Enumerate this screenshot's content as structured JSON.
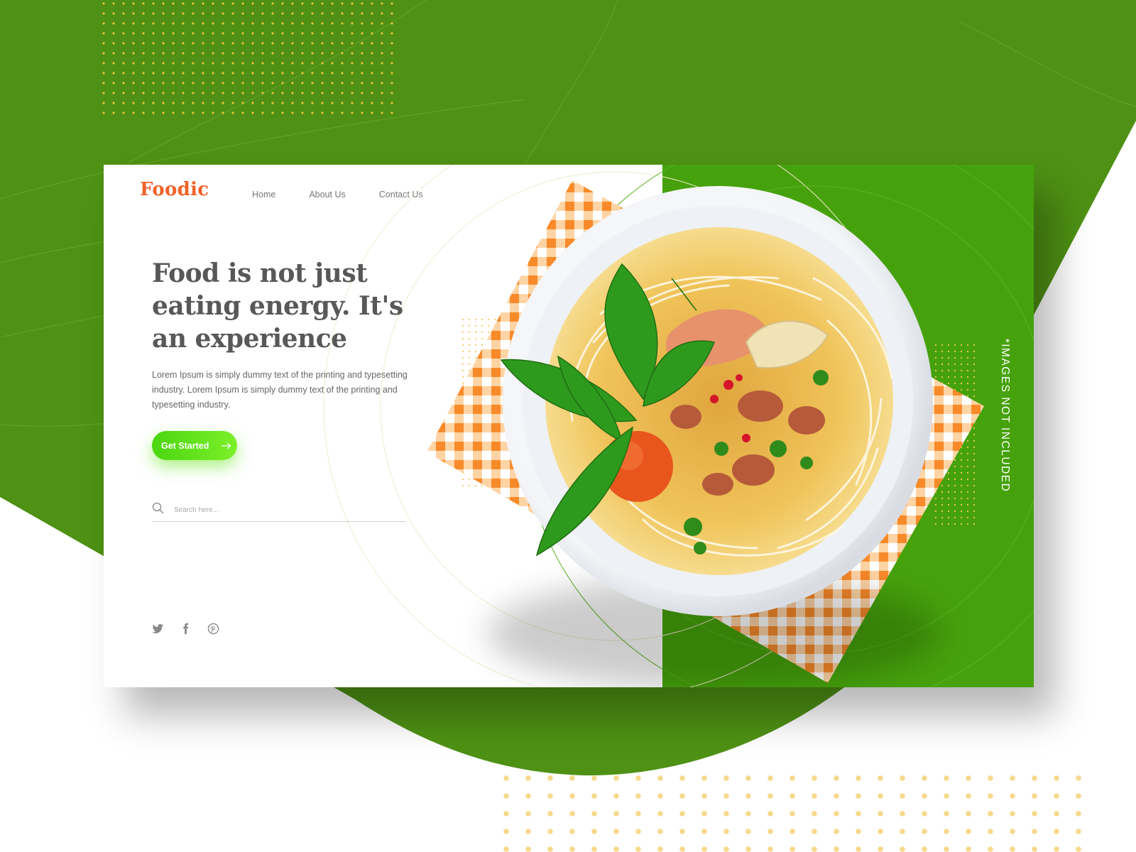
{
  "brand": {
    "name": "Foodic"
  },
  "nav": {
    "items": [
      {
        "label": "Home"
      },
      {
        "label": "About Us"
      },
      {
        "label": "Contact Us"
      }
    ]
  },
  "hero": {
    "headline": "Food is not just eating energy. It's an experience",
    "body": "Lorem Ipsum is simply dummy text of the printing and typesetting industry. Lorem Ipsum is simply dummy text of the printing and typesetting industry.",
    "cta_label": "Get Started"
  },
  "search": {
    "placeholder": "Search here..."
  },
  "social": {
    "icons": [
      "twitter-icon",
      "facebook-icon",
      "pinterest-icon"
    ]
  },
  "side_note": "*IMAGES NOT INCLUDED",
  "colors": {
    "background_green": "#4e9114",
    "panel_green": "#46a20c",
    "brand_orange": "#f2622a",
    "cta_green": "#5fe01a",
    "dot_yellow": "#f5d27a",
    "text_gray": "#585858"
  }
}
